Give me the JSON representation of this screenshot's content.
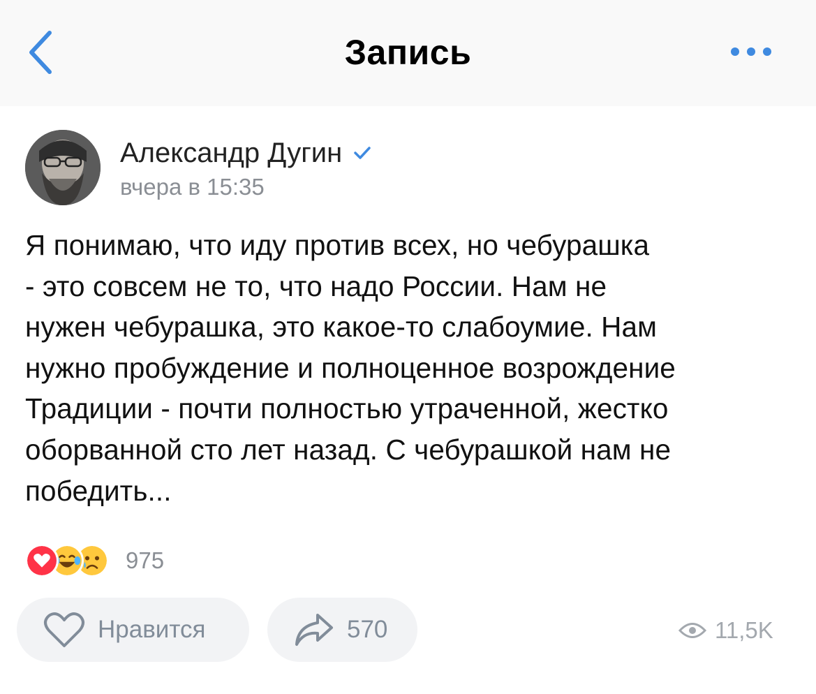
{
  "nav": {
    "title": "Запись",
    "back_icon": "chevron-left-icon",
    "more_icon": "more-horizontal-icon",
    "accent_color": "#3f8ae0"
  },
  "post": {
    "author": "Александр Дугин",
    "verified": true,
    "time": "вчера в 15:35",
    "text_lines": [
      "Я понимаю, что иду против всех, но чебурашка",
      "- это совсем не то, что надо России. Нам не",
      "нужен чебурашка, это какое-то слабоумие. Нам",
      "нужно пробуждение и полноценное возрождение",
      "Традиции - почти полностью утраченной, жестко",
      "оборванной сто лет назад. С чебурашкой нам не",
      "победить..."
    ]
  },
  "reactions": {
    "icons": [
      "heart-reaction-icon",
      "laughing-tears-reaction-icon",
      "crying-reaction-icon"
    ],
    "count": "975"
  },
  "actions": {
    "like_label": "Нравится",
    "like_icon": "heart-outline-icon",
    "share_count": "570",
    "share_icon": "share-arrow-icon",
    "views_count": "11,5K",
    "views_icon": "eye-icon"
  }
}
